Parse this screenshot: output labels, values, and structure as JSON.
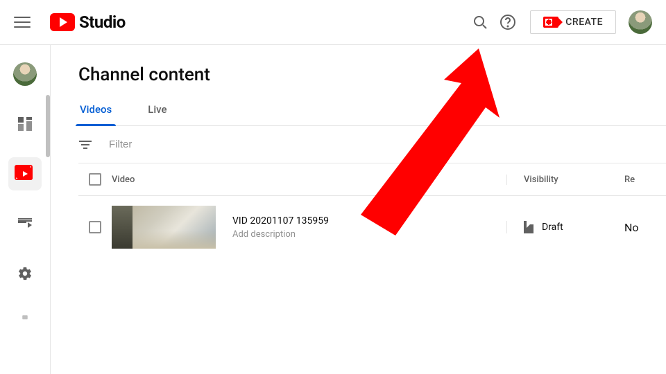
{
  "header": {
    "logo_word": "Studio",
    "create_label": "CREATE"
  },
  "sidebar": {
    "items": [
      "channel-avatar",
      "dashboard",
      "content",
      "playlists",
      "settings",
      "feedback"
    ]
  },
  "page": {
    "title": "Channel content",
    "tabs": [
      {
        "id": "videos",
        "label": "Videos",
        "active": true
      },
      {
        "id": "live",
        "label": "Live",
        "active": false
      }
    ],
    "filter_placeholder": "Filter",
    "columns": {
      "video": "Video",
      "visibility": "Visibility",
      "restrictions": "Re"
    },
    "rows": [
      {
        "title": "VID 20201107 135959",
        "description_placeholder": "Add description",
        "visibility": "Draft",
        "restrictions": "No"
      }
    ]
  }
}
